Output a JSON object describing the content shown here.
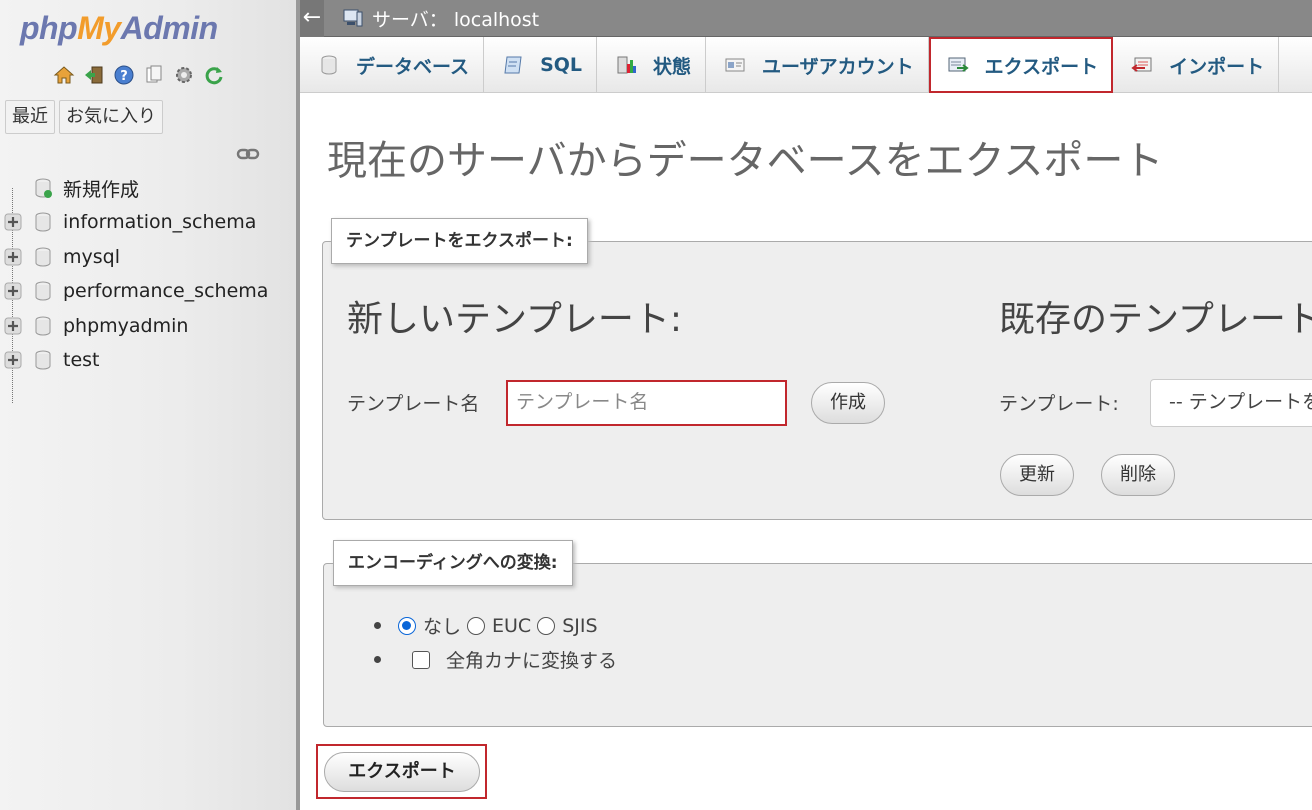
{
  "sidebar": {
    "logo": {
      "php": "php",
      "my": "My",
      "admin": "Admin"
    },
    "nav_icons": [
      "home-icon",
      "exit-icon",
      "help-icon",
      "docs-icon",
      "settings-icon",
      "reload-icon"
    ],
    "recent_label": "最近",
    "favorites_label": "お気に入り",
    "link_icon": "link-icon",
    "tree": [
      {
        "label": "新規作成",
        "expandable": false
      },
      {
        "label": "information_schema",
        "expandable": true
      },
      {
        "label": "mysql",
        "expandable": true
      },
      {
        "label": "performance_schema",
        "expandable": true
      },
      {
        "label": "phpmyadmin",
        "expandable": true
      },
      {
        "label": "test",
        "expandable": true
      }
    ]
  },
  "topbar": {
    "back": "←",
    "server": "サーバ： localhost"
  },
  "menu": [
    {
      "label": "データベース",
      "icon": "database-icon"
    },
    {
      "label": "SQL",
      "icon": "sql-icon"
    },
    {
      "label": "状態",
      "icon": "status-icon"
    },
    {
      "label": "ユーザアカウント",
      "icon": "user-accounts-icon"
    },
    {
      "label": "エクスポート",
      "icon": "export-icon",
      "active": true
    },
    {
      "label": "インポート",
      "icon": "import-icon"
    }
  ],
  "page": {
    "title": "現在のサーバからデータベースをエクスポート",
    "templates": {
      "legend": "テンプレートをエクスポート:",
      "new_title": "新しいテンプレート:",
      "name_label": "テンプレート名",
      "name_placeholder": "テンプレート名",
      "create_button": "作成",
      "existing_title": "既存のテンプレート:",
      "template_label": "テンプレート:",
      "template_select": "-- テンプレートを選択 --",
      "update_button": "更新",
      "delete_button": "削除"
    },
    "encoding": {
      "legend": "エンコーディングへの変換:",
      "options": [
        {
          "label": "なし",
          "checked": true
        },
        {
          "label": "EUC",
          "checked": false
        },
        {
          "label": "SJIS",
          "checked": false
        }
      ],
      "kana_label": "全角カナに変換する",
      "kana_checked": false
    },
    "export_button": "エクスポート"
  }
}
